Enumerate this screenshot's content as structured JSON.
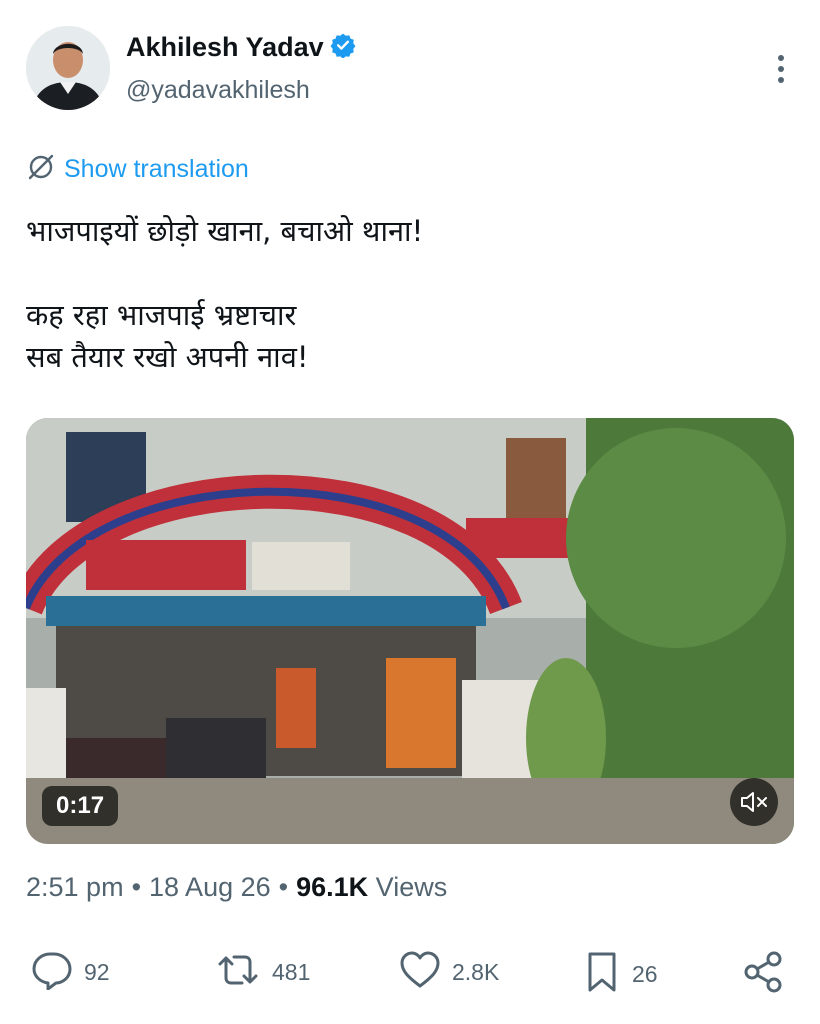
{
  "author": {
    "name": "Akhilesh Yadav",
    "handle": "@yadavakhilesh",
    "verified_icon": "verified-badge-icon"
  },
  "translate": {
    "label": "Show translation"
  },
  "tweet": {
    "line1": "भाजपाइयों छोड़ो खाना, बचाओ थाना!",
    "line2": "कह रहा भाजपाई भ्रष्टाचार",
    "line3": "सब तैयार रखो अपनी नाव!"
  },
  "media": {
    "duration": "0:17",
    "mute_icon": "muted-speaker-icon"
  },
  "meta": {
    "time": "2:51 pm",
    "separator": "•",
    "date": "18 Aug 26",
    "views_count": "96.1K",
    "views_label": "Views"
  },
  "actions": {
    "replies": "92",
    "reposts": "481",
    "likes": "2.8K",
    "bookmarks": "26"
  },
  "colors": {
    "accent": "#1d9bf0",
    "secondary_text": "#536471",
    "text": "#0f1419"
  }
}
